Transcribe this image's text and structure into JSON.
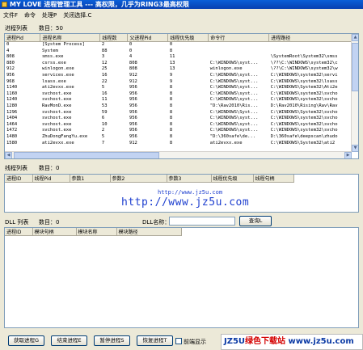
{
  "window": {
    "title": "MY LOVE 进程管理工具 --- 高权限，几乎为RING3最高权限"
  },
  "menu": {
    "items": [
      "文件F",
      "命令",
      "处理P",
      "关闭选择.C"
    ]
  },
  "process_section": {
    "label": "进程列表",
    "count_text": "数目：50",
    "columns": [
      "进程Pid",
      "进程名称",
      "线程数",
      "父进程Pid",
      "线程优先级",
      "命令行",
      "进程路径"
    ],
    "rows": [
      [
        "0",
        "[System Process]",
        "2",
        "0",
        "0",
        "",
        ""
      ],
      [
        "4",
        "System",
        "88",
        "0",
        "8",
        "",
        ""
      ],
      [
        "808",
        "smss.exe",
        "3",
        "4",
        "11",
        "",
        "\\SystemRoot\\System32\\smss"
      ],
      [
        "880",
        "csrss.exe",
        "12",
        "808",
        "13",
        "C:\\WINDOWS\\syst...",
        "\\??\\C:\\WINDOWS\\system32\\c"
      ],
      [
        "912",
        "winlogon.exe",
        "25",
        "808",
        "13",
        "winlogon.exe",
        "\\??\\C:\\WINDOWS\\system32\\w"
      ],
      [
        "956",
        "services.exe",
        "16",
        "912",
        "9",
        "C:\\WINDOWS\\syst...",
        "C:\\WINDOWS\\system32\\servi"
      ],
      [
        "968",
        "lsass.exe",
        "22",
        "912",
        "9",
        "C:\\WINDOWS\\syst...",
        "C:\\WINDOWS\\system32\\lsass"
      ],
      [
        "1140",
        "ati2evxx.exe",
        "5",
        "956",
        "8",
        "C:\\WINDOWS\\syst...",
        "C:\\WINDOWS\\System32\\Ati2e"
      ],
      [
        "1160",
        "svchost.exe",
        "16",
        "956",
        "8",
        "C:\\WINDOWS\\syst...",
        "C:\\WINDOWS\\system32\\svcho"
      ],
      [
        "1240",
        "svchost.exe",
        "11",
        "956",
        "8",
        "C:\\WINDOWS\\syst...",
        "C:\\WINDOWS\\system32\\svcho"
      ],
      [
        "1280",
        "RavMonD.exe",
        "53",
        "956",
        "8",
        "\"D:\\Rav2010\\Ris...",
        "D:\\Rav2010\\Rising\\Rav\\Rav"
      ],
      [
        "1296",
        "svchost.exe",
        "59",
        "956",
        "8",
        "C:\\WINDOWS\\Syst...",
        "C:\\WINDOWS\\System32\\svcho"
      ],
      [
        "1404",
        "svchost.exe",
        "6",
        "956",
        "8",
        "C:\\WINDOWS\\syst...",
        "C:\\WINDOWS\\system32\\svcho"
      ],
      [
        "1464",
        "svchost.exe",
        "10",
        "956",
        "8",
        "C:\\WINDOWS\\syst...",
        "C:\\WINDOWS\\system32\\svcho"
      ],
      [
        "1472",
        "svchost.exe",
        "2",
        "956",
        "8",
        "C:\\WINDOWS\\syst...",
        "C:\\WINDOWS\\system32\\svcho"
      ],
      [
        "1480",
        "ZhuDongFangYu.exe",
        "5",
        "956",
        "8",
        "\"D:\\360safe\\de...",
        "D:\\360safe\\deepscan\\zhudo"
      ],
      [
        "1580",
        "ati2evxx.exe",
        "7",
        "912",
        "8",
        "ati2evxx.exe",
        "C:\\WINDOWS\\System32\\ati2"
      ]
    ]
  },
  "thread_section": {
    "label": "线程列表",
    "count_text": "数目：0",
    "columns": [
      "进程ID",
      "线程Pid",
      "参数1",
      "参数2",
      "参数3",
      "线程优先级",
      "线程句柄"
    ]
  },
  "dll_section": {
    "label": "DLL 列表",
    "count_text": "数目：0",
    "name_label": "DLL名称：",
    "name_value": "",
    "query_button": "查询L",
    "columns": [
      "进程ID",
      "模块句柄",
      "模块名称",
      "模块路径"
    ]
  },
  "watermark": {
    "small": "http://www.jz5u.com",
    "large": "http://www.jz5u.com"
  },
  "buttons": {
    "get_process": "获取进程G",
    "end_process": "结束进程E",
    "suspend_process": "暂停进程S",
    "resume_process": "恢复进程T",
    "top_display_label": "前端显示"
  },
  "brand": {
    "part1": "JZ5U",
    "part2": "绿色下载站",
    "part3": "www.jz5u.com"
  },
  "colors": {
    "title_bar": "#0a5fd8",
    "watermark": "#1e3fcf",
    "brand_red": "#d40000",
    "brand_blue": "#0b3aa5"
  }
}
